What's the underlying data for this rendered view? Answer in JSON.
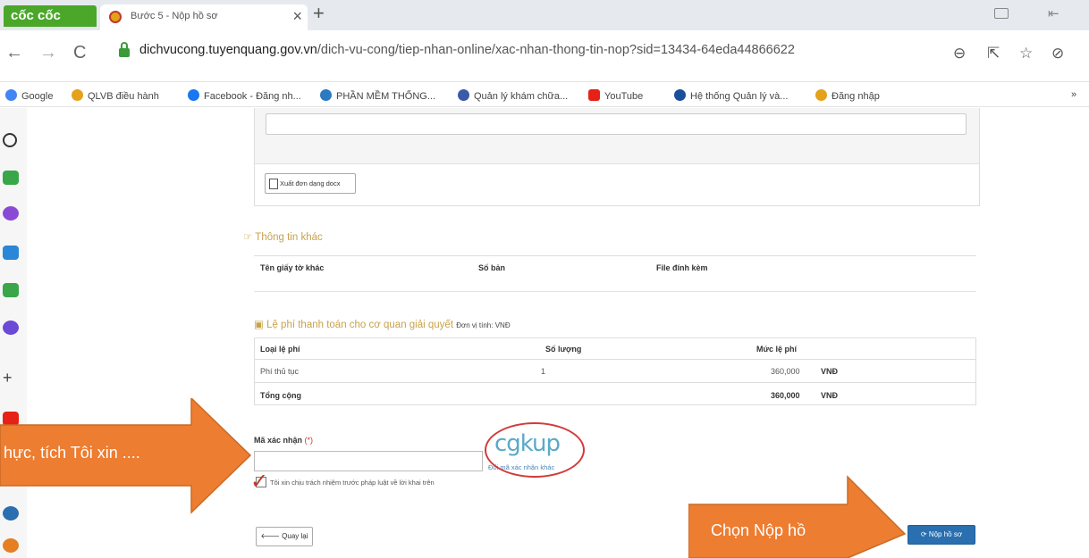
{
  "browser": {
    "brand": "cốc cốc",
    "tab_title": "Bước 5 - Nộp hồ sơ",
    "tab_close": "×",
    "new_tab": "+",
    "url_host": "dichvucong.tuyenquang.gov.vn",
    "url_path": "/dich-vu-cong/tiep-nhan-online/xac-nhan-thong-tin-nop?sid=13434-64eda44866622",
    "back": "←",
    "forward": "→",
    "reload": "C",
    "more_bookmarks": "»",
    "bookmarks": [
      {
        "label": "Google",
        "color": "#4285f4"
      },
      {
        "label": "QLVB điều hành",
        "color": "#e3a21a"
      },
      {
        "label": "Facebook - Đăng nh...",
        "color": "#1877f2"
      },
      {
        "label": "PHẦN MỀM THỐNG...",
        "color": "#2a7bbf"
      },
      {
        "label": "Quản lý khám chữa...",
        "color": "#3b5aa8"
      },
      {
        "label": "YouTube",
        "color": "#e62117"
      },
      {
        "label": "Hệ thống Quản lý và...",
        "color": "#1a4f9c"
      },
      {
        "label": "Đăng nhập",
        "color": "#e3a21a"
      }
    ]
  },
  "page": {
    "export_button": "Xuất đơn dạng docx",
    "other_info": {
      "title": "Thông tin khác",
      "headers": [
        "Tên giấy tờ khác",
        "Số bản",
        "File đính kèm"
      ]
    },
    "fees": {
      "title": "Lệ phí thanh toán cho cơ quan giải quyết",
      "unit_label": "Đơn vị tính: VNĐ",
      "headers": [
        "Loại lệ phí",
        "Số lượng",
        "Mức lệ phí"
      ],
      "rows": [
        {
          "name": "Phí thủ tục",
          "qty": "1",
          "amount": "360,000",
          "currency": "VNĐ"
        }
      ],
      "total": {
        "name": "Tổng cộng",
        "amount": "360,000",
        "currency": "VNĐ"
      }
    },
    "captcha": {
      "label": "Mã xác nhận",
      "required_mark": "(*)",
      "image_text": "cgkup",
      "change_link": "Đổi mã xác nhận khác"
    },
    "agreement": "Tôi xin chịu trách nhiệm trước pháp luật về lời khai trên",
    "back_button": "Quay lại",
    "submit_button": "Nộp hồ sơ"
  },
  "annotations": {
    "left_arrow": "hực, tích Tôi xin ....",
    "right_arrow": "Chọn  Nộp hồ"
  },
  "colors": {
    "annotation_orange": "#ed7d31",
    "section_gold": "#c8a24b",
    "primary_blue": "#2a6fb0",
    "circle_red": "#d23b3b"
  }
}
